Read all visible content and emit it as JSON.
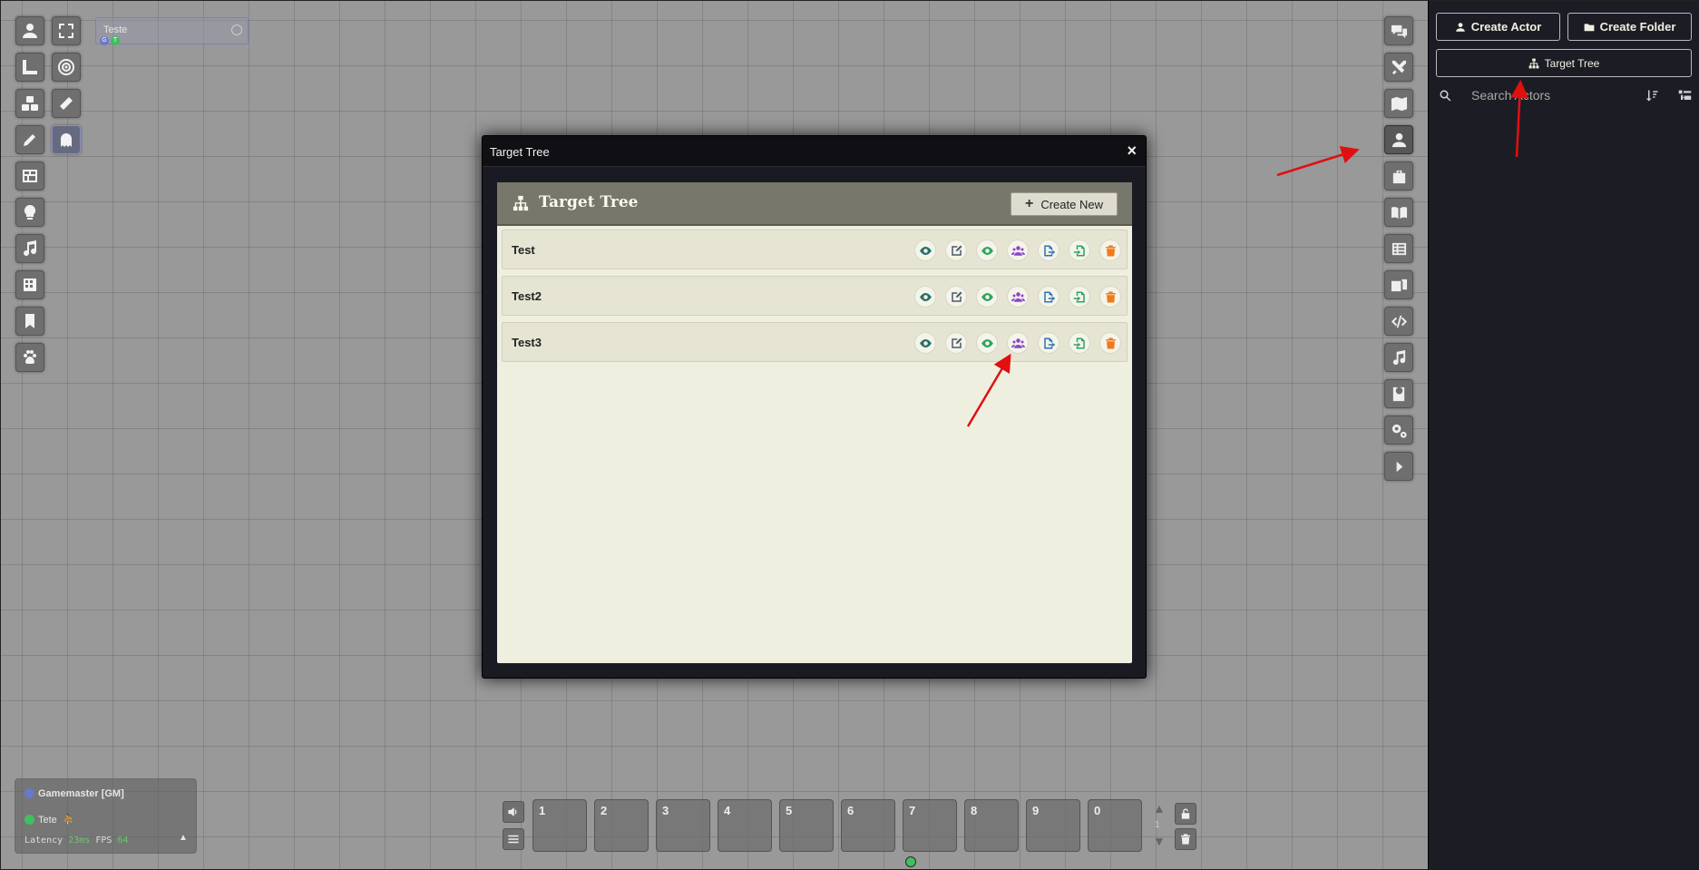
{
  "scene": {
    "name": "Teste",
    "badges": [
      "G",
      "T"
    ]
  },
  "dialog": {
    "window_title": "Target Tree",
    "close_glyph": "×",
    "header_title": "Target Tree",
    "create_new_label": "Create New",
    "rows": [
      {
        "label": "Test"
      },
      {
        "label": "Test2"
      },
      {
        "label": "Test3"
      }
    ],
    "row_actions": [
      "view-icon",
      "edit-icon",
      "visibility-icon",
      "users-icon",
      "export-icon",
      "import-icon",
      "delete-icon"
    ],
    "action_colors": {
      "view": "#2b6f6a",
      "edit": "#4a5a6a",
      "visibility": "#2fa45f",
      "users": "#8a47c9",
      "export": "#2f72b5",
      "import": "#2fa45f",
      "delete": "#f07a1a"
    }
  },
  "sidebar": {
    "create_actor_label": "Create Actor",
    "create_folder_label": "Create Folder",
    "target_tree_label": "Target Tree",
    "search_placeholder": "Search Actors"
  },
  "players": {
    "gm_name": "Gamemaster [GM]",
    "player_name": "Tete",
    "latency_label": "Latency",
    "latency_value": "23ms",
    "fps_label": "FPS",
    "fps_value": "64"
  },
  "hotbar": {
    "slots": [
      "1",
      "2",
      "3",
      "4",
      "5",
      "6",
      "7",
      "8",
      "9",
      "0"
    ],
    "page": "1"
  },
  "colors": {
    "annotation_arrow": "#e01010",
    "gm_dot": "#6a78c8",
    "player_dot": "#3fbf5f"
  }
}
